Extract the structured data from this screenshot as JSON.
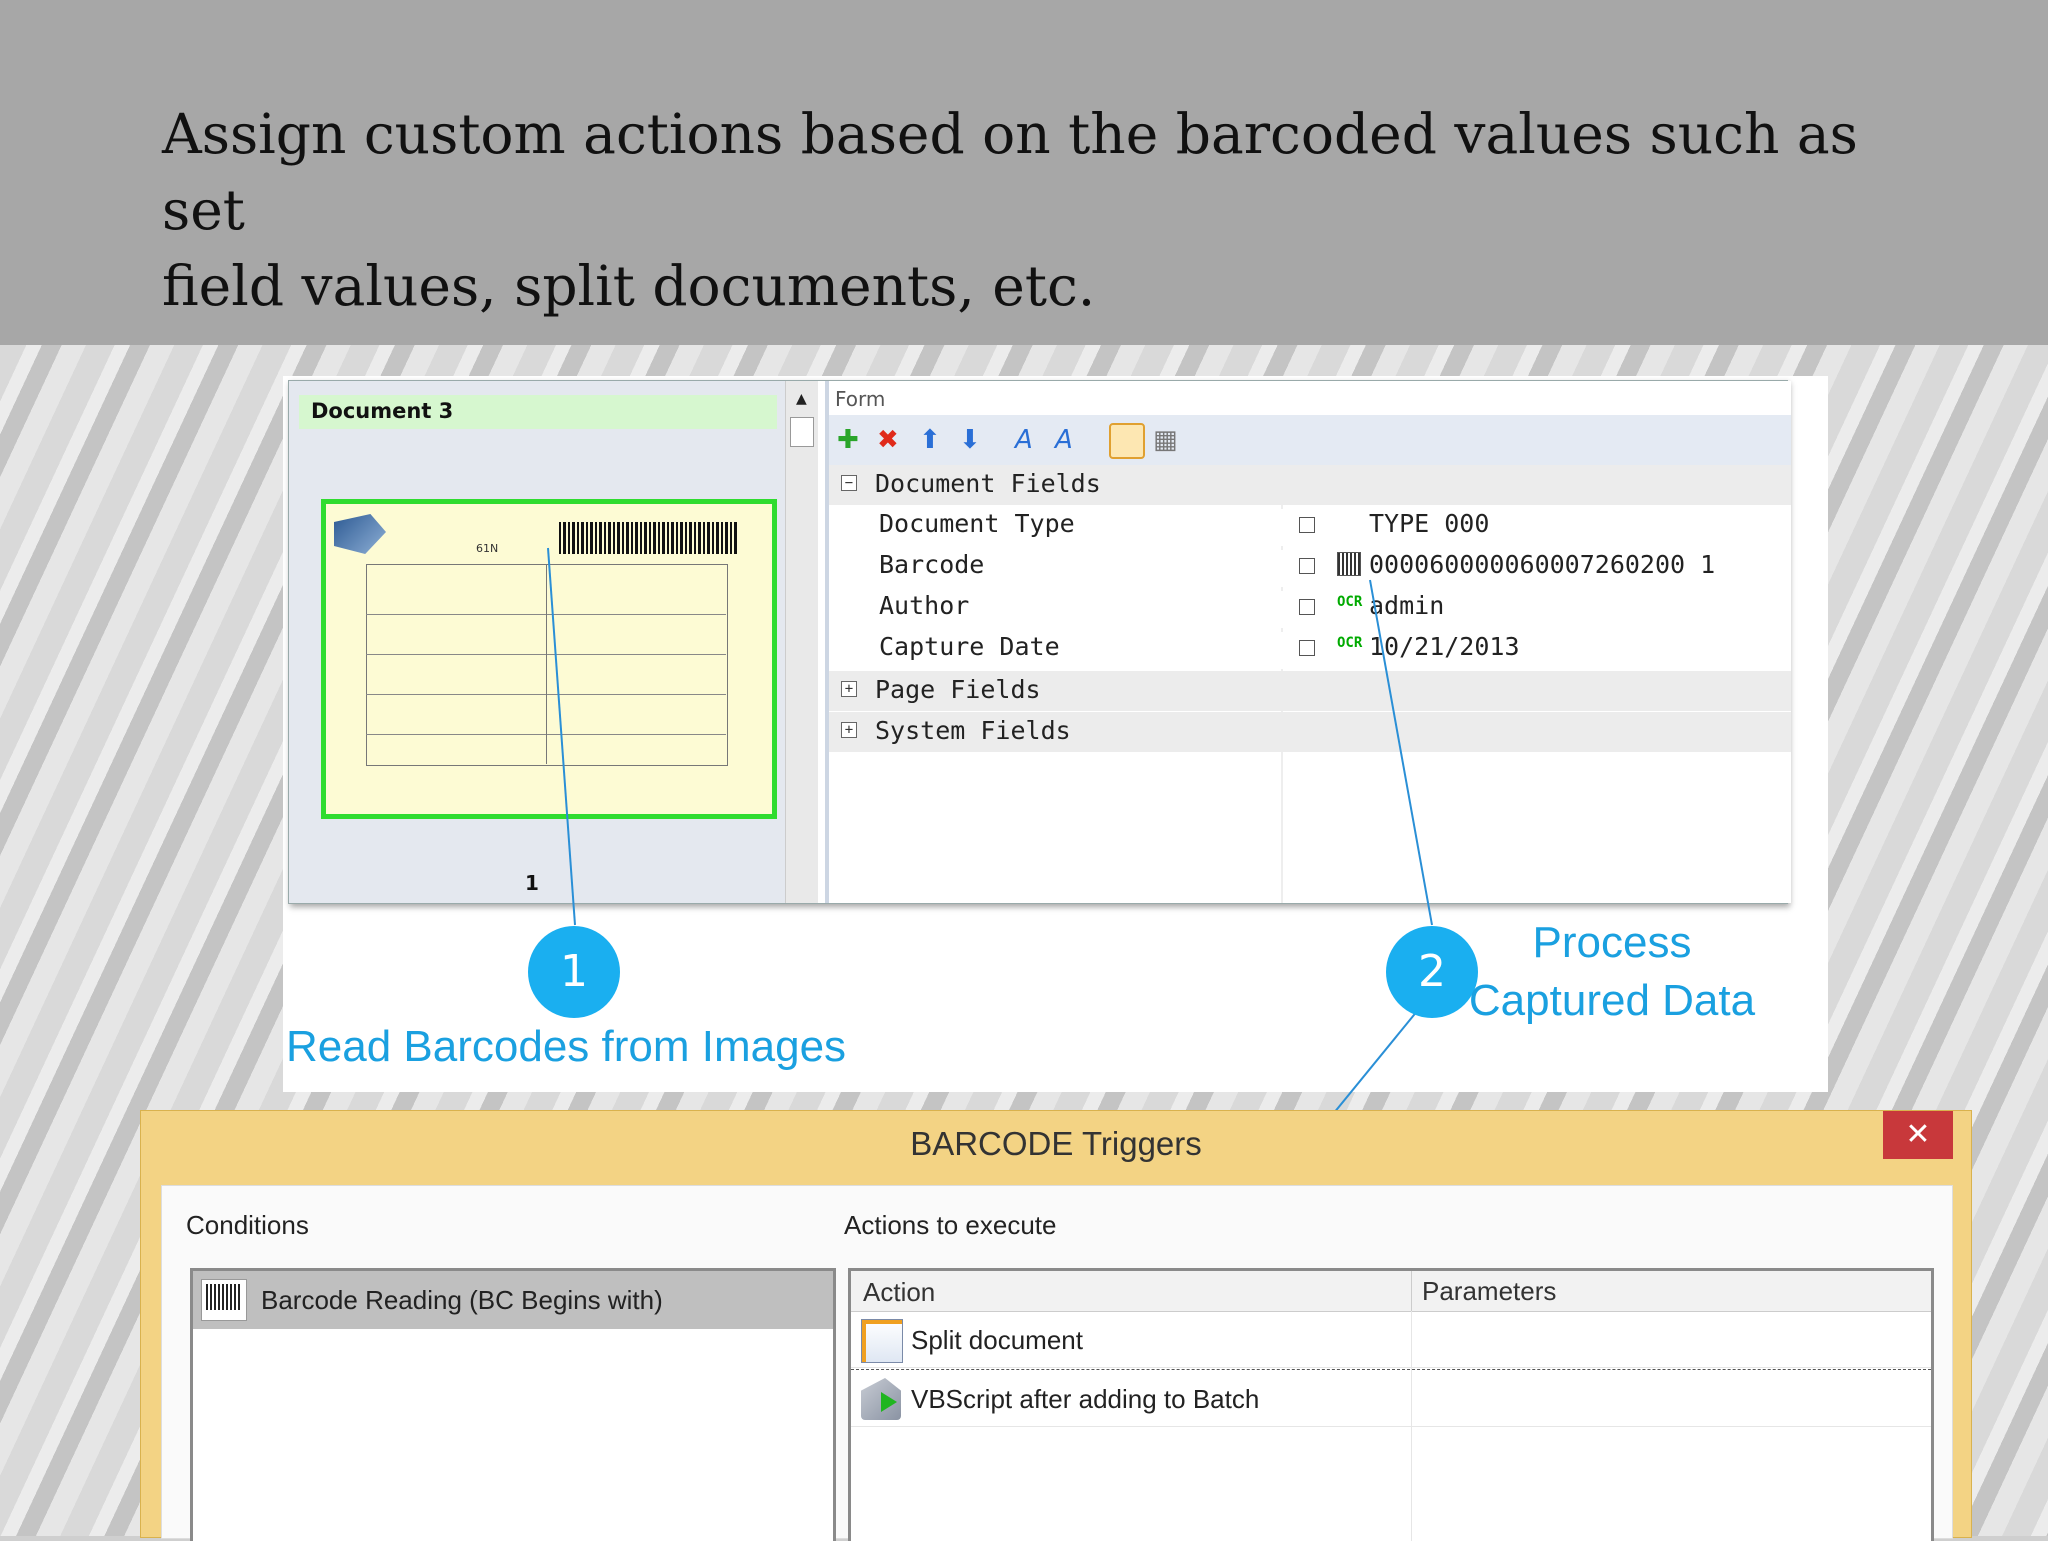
{
  "slide": {
    "title_line1": "Assign custom actions based on the barcoded values such as set",
    "title_line2": "field values, split documents, etc."
  },
  "app": {
    "document_title": "Document 3",
    "page_number": "1",
    "thumb_label": "61N",
    "form_title": "Form",
    "groups": {
      "document_fields": "Document Fields",
      "page_fields": "Page Fields",
      "system_fields": "System Fields"
    },
    "fields": [
      {
        "name": "Document Type",
        "value": "TYPE 000"
      },
      {
        "name": "Barcode",
        "value": "000060000060007260200 1"
      },
      {
        "name": "Author",
        "value": "admin"
      },
      {
        "name": "Capture Date",
        "value": "10/21/2013"
      }
    ],
    "ocr_label": "OCR"
  },
  "callouts": {
    "one_number": "1",
    "one_text": "Read Barcodes from Images",
    "two_number": "2",
    "two_text_line1": "Process",
    "two_text_line2": "Captured Data"
  },
  "dialog": {
    "title": "BARCODE Triggers",
    "close": "✕",
    "conditions_label": "Conditions",
    "actions_label": "Actions to execute",
    "condition_item": "Barcode Reading (BC Begins with)",
    "col_action": "Action",
    "col_parameters": "Parameters",
    "actions": [
      "Split document",
      "VBScript after adding to Batch"
    ]
  },
  "colors": {
    "accent": "#1aaff0",
    "header_bg": "#a7a7a7",
    "dialog_frame": "#f3d384",
    "thumb_border": "#2fdc2f"
  }
}
